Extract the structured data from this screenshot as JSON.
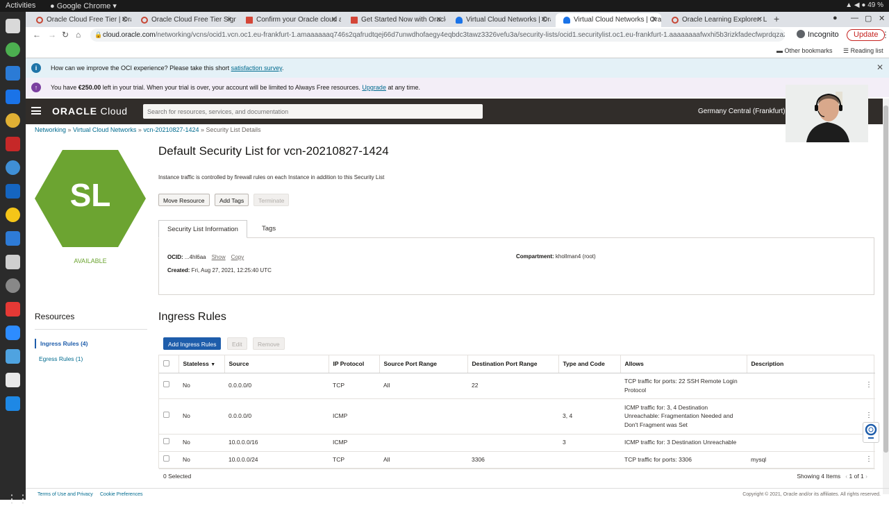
{
  "os": {
    "activities": "Activities",
    "app_name": "Google Chrome",
    "battery": "49 %"
  },
  "browser": {
    "tabs": [
      {
        "title": "Oracle Cloud Free Tier | Orac"
      },
      {
        "title": "Oracle Cloud Free Tier Signup"
      },
      {
        "title": "Confirm your Oracle cloud a"
      },
      {
        "title": "Get Started Now with Oracle"
      },
      {
        "title": "Virtual Cloud Networks | Ora"
      },
      {
        "title": "Virtual Cloud Networks | Ora"
      },
      {
        "title": "Oracle Learning Explorer: Le"
      }
    ],
    "url_host": "cloud.oracle.com",
    "url_path": "/networking/vcns/ocid1.vcn.oc1.eu-frankfurt-1.amaaaaaaq746s2qafrudtqej66d7unwdhofaegy4eqbdc3tawz3326vefu3a/security-lists/ocid1.securitylist.oc1.eu-frankfurt-1.aaaaaaaafwxhi5b3rizkfadecfwprdqza222v5zuy...",
    "incognito": "Incognito",
    "update": "Update",
    "bookmarks": {
      "other": "Other bookmarks",
      "reading_list": "Reading list"
    }
  },
  "banners": {
    "survey_text": "How can we improve the OCI experience? Please take this short ",
    "survey_link": "satisfaction survey",
    "survey_end": ".",
    "trial_pre": "You have ",
    "trial_amount": "€250.00",
    "trial_mid": " left in your trial. When your trial is over, your account will be limited to Always Free resources. ",
    "trial_link": "Upgrade",
    "trial_end": " at any time."
  },
  "header": {
    "logo_a": "ORACLE",
    "logo_b": " Cloud",
    "search_placeholder": "Search for resources, services, and documentation",
    "region": "Germany Central (Frankfurt)"
  },
  "breadcrumb": {
    "items": [
      "Networking",
      "Virtual Cloud Networks",
      "vcn-20210827-1424"
    ],
    "current": "Security List Details",
    "sep": " » "
  },
  "resource": {
    "initials": "SL",
    "status": "AVAILABLE",
    "title": "Default Security List for vcn-20210827-1424",
    "description": "Instance traffic is controlled by firewall rules on each Instance in addition to this Security List"
  },
  "actions": {
    "move": "Move Resource",
    "add_tags": "Add Tags",
    "terminate": "Terminate"
  },
  "info_tabs": [
    "Security List Information",
    "Tags"
  ],
  "info": {
    "ocid_label": "OCID:",
    "ocid_value": " ...4hl6aa",
    "show": "Show",
    "copy": "Copy",
    "created_label": "Created:",
    "created_value": " Fri, Aug 27, 2021, 12:25:40 UTC",
    "compartment_label": "Compartment:",
    "compartment_value": " khollman4 (root)"
  },
  "resources": {
    "title": "Resources",
    "items": [
      "Ingress Rules (4)",
      "Egress Rules (1)"
    ]
  },
  "ingress": {
    "title": "Ingress Rules",
    "buttons": {
      "add": "Add Ingress Rules",
      "edit": "Edit",
      "remove": "Remove"
    },
    "columns": [
      "Stateless",
      "Source",
      "IP Protocol",
      "Source Port Range",
      "Destination Port Range",
      "Type and Code",
      "Allows",
      "Description"
    ],
    "sort_indicator": "▼",
    "rows": [
      {
        "stateless": "No",
        "source": "0.0.0.0/0",
        "protocol": "TCP",
        "src_port": "All",
        "dst_port": "22",
        "type_code": "",
        "allows": "TCP traffic for ports: 22 SSH Remote Login Protocol",
        "description": ""
      },
      {
        "stateless": "No",
        "source": "0.0.0.0/0",
        "protocol": "ICMP",
        "src_port": "",
        "dst_port": "",
        "type_code": "3, 4",
        "allows": "ICMP traffic for: 3, 4 Destination Unreachable: Fragmentation Needed and Don't Fragment was Set",
        "description": ""
      },
      {
        "stateless": "No",
        "source": "10.0.0.0/16",
        "protocol": "ICMP",
        "src_port": "",
        "dst_port": "",
        "type_code": "3",
        "allows": "ICMP traffic for: 3 Destination Unreachable",
        "description": ""
      },
      {
        "stateless": "No",
        "source": "10.0.0.0/24",
        "protocol": "TCP",
        "src_port": "All",
        "dst_port": "3306",
        "type_code": "",
        "allows": "TCP traffic for ports: 3306",
        "description": "mysql"
      }
    ],
    "selected": "0 Selected",
    "showing": "Showing 4 Items",
    "pager": "1 of 1"
  },
  "footer": {
    "terms": "Terms of Use and Privacy",
    "cookies": "Cookie Preferences",
    "copyright": "Copyright © 2021, Oracle and/or its affiliates. All rights reserved."
  },
  "colors": {
    "oracle_header": "#312d2a",
    "hex_green": "#6ca431",
    "primary_button": "#1e5dab",
    "link": "#006b8f"
  }
}
